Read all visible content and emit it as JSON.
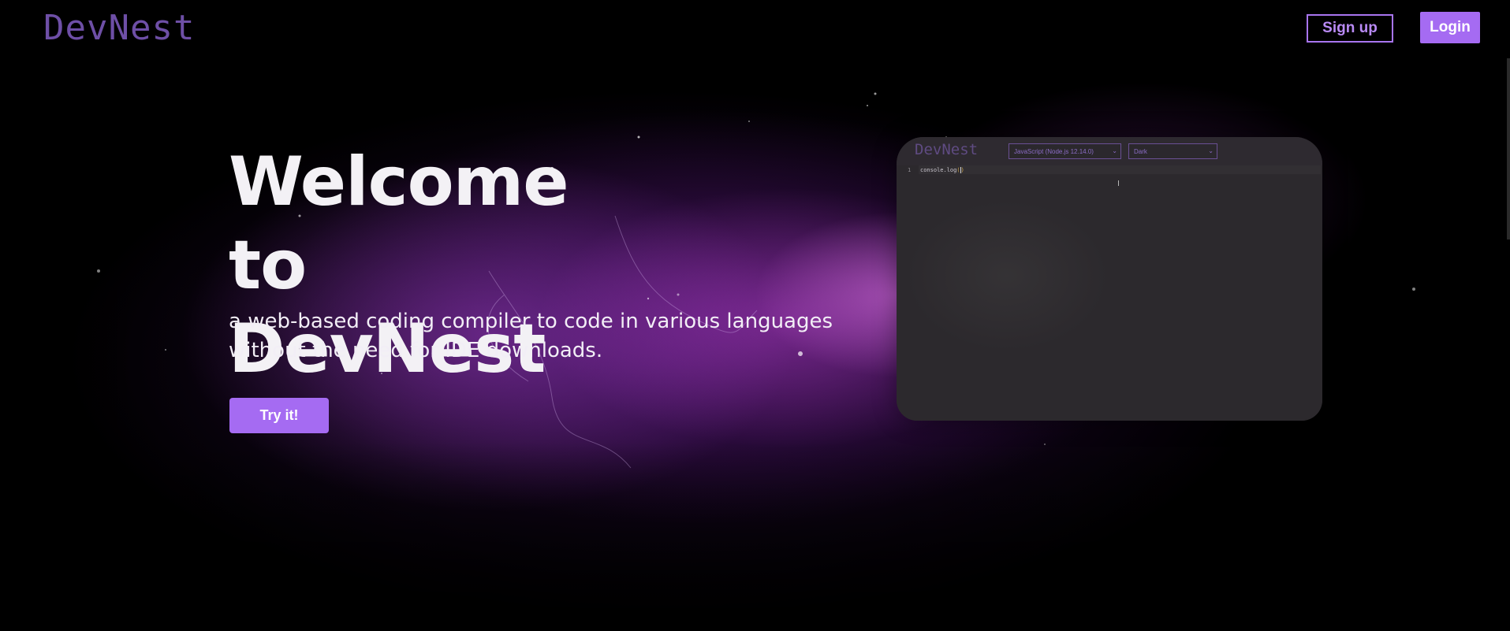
{
  "header": {
    "logo": "DevNest",
    "signup_label": "Sign up",
    "login_label": "Login"
  },
  "hero": {
    "title_line1": "Welcome",
    "title_line2": "to DevNest",
    "subtitle_line1": "a web-based coding compiler to code in various languages",
    "subtitle_line2": "without the need for IDE downloads.",
    "cta_label": "Try it!"
  },
  "editor": {
    "logo": "DevNest",
    "language": "JavaScript (Node.js 12.14.0)",
    "theme": "Dark",
    "line_number": "1",
    "code_prefix": "console.log",
    "code_open": "(",
    "code_close": ")"
  },
  "colors": {
    "accent": "#a56bf2",
    "logo": "#6e4fa6",
    "background": "#000000"
  },
  "icons": {
    "select_caret": "chevron-down-icon"
  }
}
